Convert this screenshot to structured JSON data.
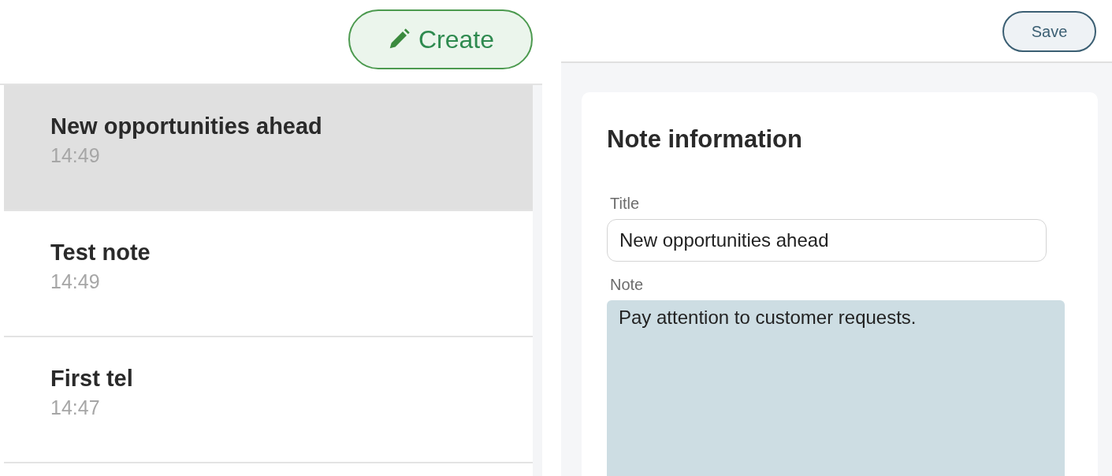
{
  "toolbar": {
    "create_button": "Create"
  },
  "notes": [
    {
      "title": "New opportunities ahead",
      "time": "14:49",
      "selected": true
    },
    {
      "title": "Test note",
      "time": "14:49",
      "selected": false
    },
    {
      "title": "First tel",
      "time": "14:47",
      "selected": false
    }
  ],
  "editor": {
    "save_button": "Save",
    "heading": "Note information",
    "fields": [
      {
        "kind": "input",
        "label": "Title",
        "value": "New opportunities ahead"
      },
      {
        "kind": "textarea",
        "label": "Note",
        "value": "Pay attention to customer requests."
      }
    ]
  }
}
